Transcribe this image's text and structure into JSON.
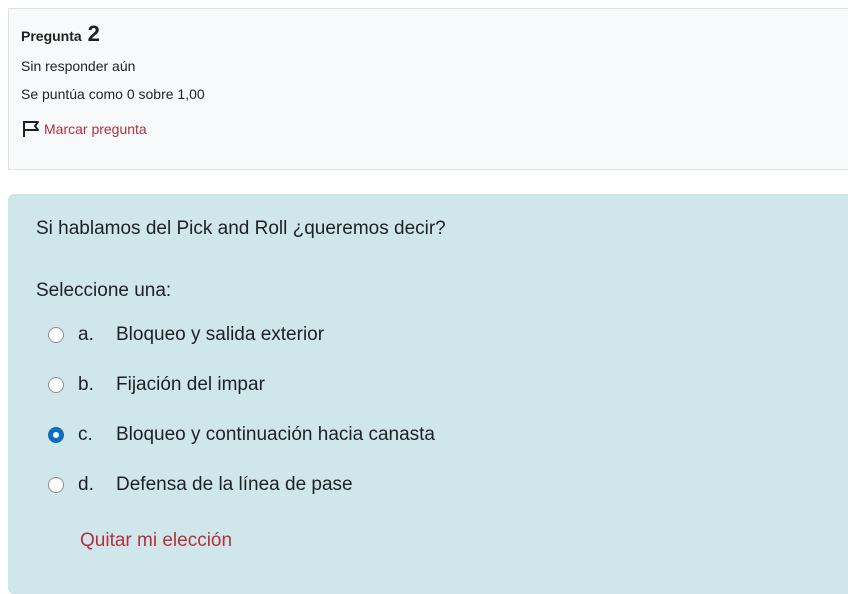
{
  "info": {
    "title_label": "Pregunta",
    "number": "2",
    "status": "Sin responder aún",
    "grade": "Se puntúa como 0 sobre 1,00",
    "flag_label": "Marcar pregunta"
  },
  "question": {
    "text": "Si hablamos del Pick and Roll ¿queremos decir?",
    "prompt": "Seleccione una:",
    "answers": [
      {
        "letter": "a.",
        "text": "Bloqueo y salida exterior",
        "selected": false
      },
      {
        "letter": "b.",
        "text": "Fijación del impar",
        "selected": false
      },
      {
        "letter": "c.",
        "text": "Bloqueo y continuación hacia canasta",
        "selected": true
      },
      {
        "letter": "d.",
        "text": "Defensa de la línea de pase",
        "selected": false
      }
    ],
    "clear_label": "Quitar mi elección"
  },
  "colors": {
    "accent": "#0f6cbf",
    "link": "#b3303c",
    "content_bg": "#cfe6ea",
    "info_bg": "#f8f9fa"
  },
  "icons": {
    "flag": "flag-icon",
    "radio": "radio-button"
  }
}
